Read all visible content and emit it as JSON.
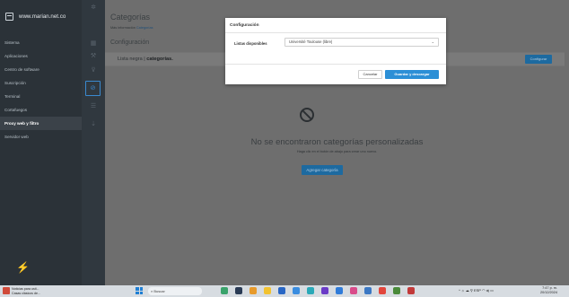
{
  "sidebar": {
    "brand": "www.marian.net.co",
    "brand_icon": "window-icon",
    "items": [
      {
        "label": "Sistema",
        "active": false
      },
      {
        "label": "Aplicaciones",
        "active": false
      },
      {
        "label": "Centro de software",
        "active": false
      },
      {
        "label": "Suscripción",
        "active": false
      },
      {
        "label": "Terminal",
        "active": false
      },
      {
        "label": "Cortafuegos",
        "active": false
      },
      {
        "label": "Proxy web y filtro",
        "active": true
      },
      {
        "label": "Servidor web",
        "active": false
      }
    ]
  },
  "header": {
    "title": "Categorías",
    "subtitle_prefix": "Más información",
    "subtitle_link": "Categorías"
  },
  "card": {
    "title": "Configuración",
    "lista_prefix": "Lista negra |",
    "lista_value": "categorías.",
    "configure_label": "Configurar"
  },
  "empty_state": {
    "icon": "ban-icon",
    "title": "No se encontraron categorías personalizadas",
    "subtitle": "Haga clic en el botón de abajo para crear uno nuevo.",
    "add_label": "Agregar categoría"
  },
  "modal": {
    "title": "Configuración",
    "field_label": "Listas disponibles",
    "select_value": "Université Toulouse (libre)",
    "cancel_label": "Cancelar",
    "save_label": "Guardar y descargar"
  },
  "taskbar": {
    "news_line1": "Noticias para usti...",
    "news_line2": "Casas clásicos de...",
    "search_placeholder": "Buscar",
    "lang": "ESP",
    "lang2": "LAA",
    "time": "7:47 p. m.",
    "date": "20/12/2024"
  },
  "colors": {
    "accent": "#2c8fd6",
    "sidebar_bg": "#2b3238",
    "overlay_bg": "#6e6e6e"
  }
}
